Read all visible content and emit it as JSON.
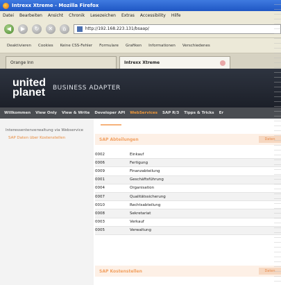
{
  "window": {
    "title": "Intrexx Xtreme - Mozilla Firefox"
  },
  "menubar": {
    "items": [
      "Datei",
      "Bearbeiten",
      "Ansicht",
      "Chronik",
      "Lesezeichen",
      "Extras",
      "Accessibility",
      "Hilfe"
    ]
  },
  "navbar": {
    "url": "http://192.168.223.131/bsaap/"
  },
  "devbar": {
    "items": [
      "Deaktivieren",
      "Cookies",
      "Keine CSS-Fehler",
      "Formulare",
      "Grafiken",
      "Informationen",
      "Verschiedenes"
    ]
  },
  "tabs": [
    {
      "label": "Orange Inn"
    },
    {
      "label": "Intrexx Xtreme"
    }
  ],
  "header": {
    "logo_line1": "united",
    "logo_line2": "planet",
    "subtitle": "BUSINESS ADAPTER"
  },
  "mainnav": {
    "items": [
      "Willkommen",
      "View Only",
      "View & Write",
      "Developer API",
      "WebServices",
      "SAP R/3",
      "Tipps & Tricks",
      "Er"
    ]
  },
  "sidebar": {
    "heading": "Interessentenverwaltung via Webservice",
    "link": "SAP Daten über Kostenstellen"
  },
  "content": {
    "section1_title": "SAP Abteilungen",
    "section1_button": "Daten",
    "section2_title": "SAP Kostenstellen",
    "section2_button": "Daten",
    "rows": [
      {
        "code": "0002",
        "name": "Einkauf"
      },
      {
        "code": "0006",
        "name": "Fertigung"
      },
      {
        "code": "0009",
        "name": "Finanzabteilung"
      },
      {
        "code": "0001",
        "name": "Geschäftsführung"
      },
      {
        "code": "0004",
        "name": "Organisation"
      },
      {
        "code": "0007",
        "name": "Qualitätssicherung"
      },
      {
        "code": "0010",
        "name": "Rechtsabteilung"
      },
      {
        "code": "0008",
        "name": "Sekretariat"
      },
      {
        "code": "0003",
        "name": "Verkauf"
      },
      {
        "code": "0005",
        "name": "Verwaltung"
      }
    ]
  },
  "colors": {
    "accent": "#f29a3a",
    "header_bg": "#2e3440",
    "nav_bg": "#4a4d52"
  }
}
